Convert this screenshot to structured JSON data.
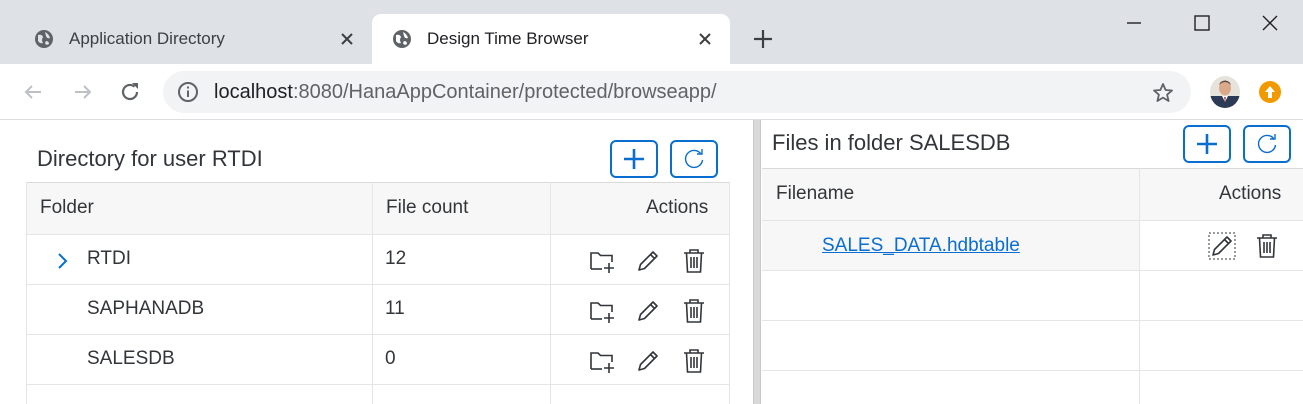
{
  "browser": {
    "tabs": [
      {
        "title": "Application Directory",
        "active": false
      },
      {
        "title": "Design Time Browser",
        "active": true
      }
    ],
    "url_host": "localhost",
    "url_rest": ":8080/HanaAppContainer/protected/browseapp/"
  },
  "left_panel": {
    "title": "Directory for user RTDI",
    "columns": {
      "folder": "Folder",
      "count": "File count",
      "actions": "Actions"
    },
    "rows": [
      {
        "folder": "RTDI",
        "count": "12",
        "expandable": true
      },
      {
        "folder": "SAPHANADB",
        "count": "11",
        "expandable": false
      },
      {
        "folder": "SALESDB",
        "count": "0",
        "expandable": false
      }
    ]
  },
  "right_panel": {
    "title": "Files in folder SALESDB",
    "columns": {
      "filename": "Filename",
      "actions": "Actions"
    },
    "rows": [
      {
        "filename": "SALES_DATA.hdbtable"
      }
    ]
  },
  "colors": {
    "accent": "#0a6ed1",
    "header_bg": "#f7f7f7",
    "tabstrip": "#dee1e6"
  },
  "icons": [
    "globe-icon",
    "close-icon",
    "plus-icon",
    "refresh-icon",
    "folder-add-icon",
    "pencil-icon",
    "trash-icon",
    "chevron-right-icon",
    "star-icon",
    "info-icon"
  ]
}
